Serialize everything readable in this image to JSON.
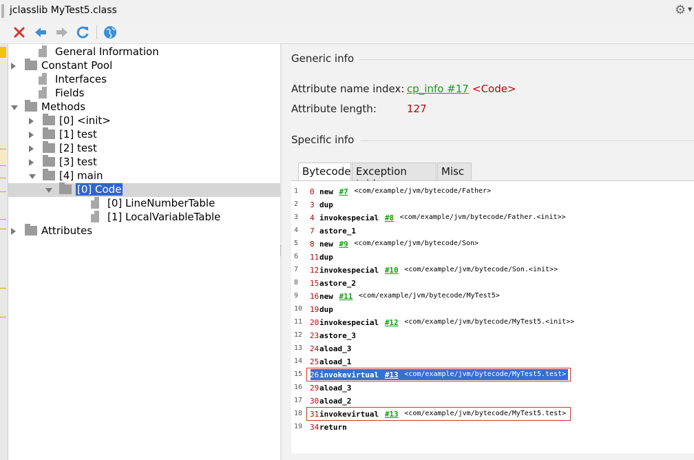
{
  "window": {
    "title": "jclasslib MyTest5.class"
  },
  "toolbar": {
    "buttons": [
      {
        "name": "close-icon",
        "color": "#d9322e"
      },
      {
        "name": "back-icon",
        "color": "#3b8fd6"
      },
      {
        "name": "forward-icon",
        "color": "#b0b0b0"
      },
      {
        "name": "reload-icon",
        "color": "#3b8fd6"
      },
      {
        "name": "web-icon",
        "color": "#3b8fd6"
      }
    ]
  },
  "tree": {
    "items": [
      {
        "label": "General Information",
        "kind": "file",
        "expand": "none"
      },
      {
        "label": "Constant Pool",
        "kind": "folder",
        "expand": "collapsed"
      },
      {
        "label": "Interfaces",
        "kind": "file",
        "expand": "none"
      },
      {
        "label": "Fields",
        "kind": "file",
        "expand": "none"
      },
      {
        "label": "Methods",
        "kind": "folder",
        "expand": "expanded"
      },
      {
        "label": "[0] <init>",
        "kind": "folder",
        "expand": "collapsed"
      },
      {
        "label": "[1] test",
        "kind": "folder",
        "expand": "collapsed"
      },
      {
        "label": "[2] test",
        "kind": "folder",
        "expand": "collapsed"
      },
      {
        "label": "[3] test",
        "kind": "folder",
        "expand": "collapsed"
      },
      {
        "label": "[4] main",
        "kind": "folder",
        "expand": "expanded"
      },
      {
        "label": "[0] Code",
        "kind": "folder",
        "expand": "expanded",
        "selected": true
      },
      {
        "label": "[0] LineNumberTable",
        "kind": "file",
        "expand": "none"
      },
      {
        "label": "[1] LocalVariableTable",
        "kind": "file",
        "expand": "none"
      },
      {
        "label": "Attributes",
        "kind": "folder",
        "expand": "collapsed"
      }
    ]
  },
  "generic": {
    "heading": "Generic info",
    "name_index_label": "Attribute name index:",
    "name_index_link": "cp_info #17",
    "name_index_value": "<Code>",
    "length_label": "Attribute length:",
    "length_value": "127"
  },
  "specific": {
    "heading": "Specific info"
  },
  "tabs": [
    {
      "label": "Bytecode",
      "active": true
    },
    {
      "label": "Exception table",
      "active": false
    },
    {
      "label": "Misc",
      "active": false
    }
  ],
  "bytecode": [
    {
      "line": "1",
      "offset": "0",
      "op": "new",
      "ref": "#7",
      "comment": "<com/example/jvm/bytecode/Father>"
    },
    {
      "line": "2",
      "offset": "3",
      "op": "dup",
      "ref": "",
      "comment": ""
    },
    {
      "line": "3",
      "offset": "4",
      "op": "invokespecial",
      "ref": "#8",
      "comment": "<com/example/jvm/bytecode/Father.<init>>"
    },
    {
      "line": "4",
      "offset": "7",
      "op": "astore_1",
      "ref": "",
      "comment": ""
    },
    {
      "line": "5",
      "offset": "8",
      "op": "new",
      "ref": "#9",
      "comment": "<com/example/jvm/bytecode/Son>"
    },
    {
      "line": "6",
      "offset": "11",
      "op": "dup",
      "ref": "",
      "comment": ""
    },
    {
      "line": "7",
      "offset": "12",
      "op": "invokespecial",
      "ref": "#10",
      "comment": "<com/example/jvm/bytecode/Son.<init>>"
    },
    {
      "line": "8",
      "offset": "15",
      "op": "astore_2",
      "ref": "",
      "comment": ""
    },
    {
      "line": "9",
      "offset": "16",
      "op": "new",
      "ref": "#11",
      "comment": "<com/example/jvm/bytecode/MyTest5>"
    },
    {
      "line": "10",
      "offset": "19",
      "op": "dup",
      "ref": "",
      "comment": ""
    },
    {
      "line": "11",
      "offset": "20",
      "op": "invokespecial",
      "ref": "#12",
      "comment": "<com/example/jvm/bytecode/MyTest5.<init>>"
    },
    {
      "line": "12",
      "offset": "23",
      "op": "astore_3",
      "ref": "",
      "comment": ""
    },
    {
      "line": "13",
      "offset": "24",
      "op": "aload_3",
      "ref": "",
      "comment": ""
    },
    {
      "line": "14",
      "offset": "25",
      "op": "aload_1",
      "ref": "",
      "comment": ""
    },
    {
      "line": "15",
      "offset": "26",
      "op": "invokevirtual",
      "ref": "#13",
      "comment": "<com/example/jvm/bytecode/MyTest5.test>",
      "highlighted": true,
      "boxed": true
    },
    {
      "line": "16",
      "offset": "29",
      "op": "aload_3",
      "ref": "",
      "comment": ""
    },
    {
      "line": "17",
      "offset": "30",
      "op": "aload_2",
      "ref": "",
      "comment": ""
    },
    {
      "line": "18",
      "offset": "31",
      "op": "invokevirtual",
      "ref": "#13",
      "comment": "<com/example/jvm/bytecode/MyTest5.test>",
      "boxed": true
    },
    {
      "line": "19",
      "offset": "34",
      "op": "return",
      "ref": "",
      "comment": ""
    }
  ]
}
